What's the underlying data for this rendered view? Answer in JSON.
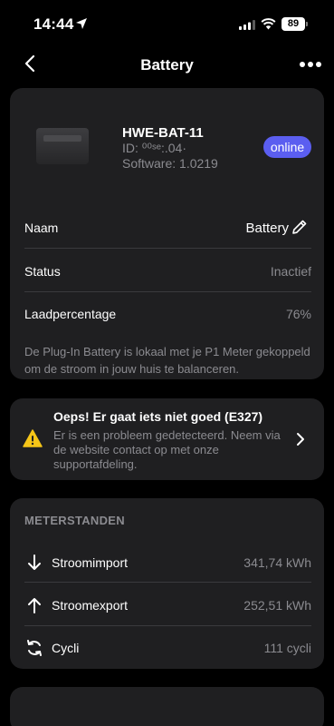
{
  "status_bar": {
    "time": "14:44",
    "battery_level": "89",
    "icons": [
      "location-arrow-icon",
      "cellular-signal-icon",
      "wifi-icon",
      "battery-icon"
    ]
  },
  "nav": {
    "title": "Battery",
    "back_icon": "chevron-left-icon",
    "more_icon": "more-horizontal-icon"
  },
  "device": {
    "name": "HWE-BAT-11",
    "id": "ID: ⁰⁰ˢᵉ:.04·",
    "software": "Software: 1.0219",
    "status_badge": "online",
    "badge_color": "#5b5ef0"
  },
  "details": {
    "rows": [
      {
        "label": "Naam",
        "value": "Battery"
      },
      {
        "label": "Status",
        "value": "Inactief"
      },
      {
        "label": "Laadpercentage",
        "value": "76%"
      }
    ],
    "description": "De Plug-In Battery is lokaal met je P1 Meter gekoppeld om de stroom in jouw huis te balanceren."
  },
  "error": {
    "title": "Oeps! Er gaat iets niet goed (E327)",
    "text": "Er is een probleem gedetecteerd. Neem via de website contact op met onze supportafdeling.",
    "icon": "warning-icon",
    "icon_color": "#f5c518"
  },
  "meters": {
    "section_title": "METERSTANDEN",
    "rows": [
      {
        "label": "Stroomimport",
        "value": "341,74 kWh",
        "icon": "arrow-down-icon"
      },
      {
        "label": "Stroomexport",
        "value": "252,51 kWh",
        "icon": "arrow-up-icon"
      },
      {
        "label": "Cycli",
        "value": "111 cycli",
        "icon": "cycle-icon"
      }
    ]
  }
}
